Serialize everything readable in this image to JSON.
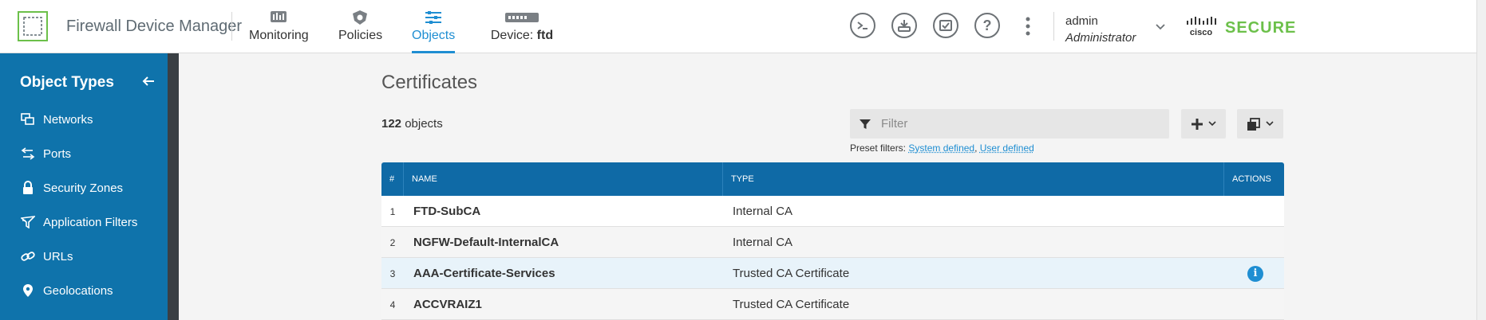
{
  "header": {
    "app_title": "Firewall Device Manager",
    "nav": [
      {
        "label": "Monitoring",
        "icon": "monitoring-icon"
      },
      {
        "label": "Policies",
        "icon": "policies-icon"
      },
      {
        "label": "Objects",
        "icon": "objects-icon",
        "active": true
      },
      {
        "label_prefix": "Device: ",
        "label_bold": "ftd",
        "icon": "device-icon"
      }
    ],
    "user": {
      "name": "admin",
      "role": "Administrator"
    },
    "brand": {
      "cisco": "cisco",
      "secure": "SECURE"
    }
  },
  "sidebar": {
    "title": "Object Types",
    "items": [
      {
        "label": "Networks",
        "icon": "networks-icon"
      },
      {
        "label": "Ports",
        "icon": "ports-icon"
      },
      {
        "label": "Security Zones",
        "icon": "lock-icon"
      },
      {
        "label": "Application Filters",
        "icon": "application-filters-icon"
      },
      {
        "label": "URLs",
        "icon": "link-icon"
      },
      {
        "label": "Geolocations",
        "icon": "location-pin-icon"
      }
    ]
  },
  "main": {
    "title": "Certificates",
    "count_number": "122",
    "count_suffix": " objects",
    "filter_placeholder": "Filter",
    "preset_label": "Preset filters:",
    "preset_filters": [
      "System defined",
      "User defined"
    ],
    "table": {
      "columns": [
        "#",
        "NAME",
        "TYPE",
        "ACTIONS"
      ],
      "rows": [
        {
          "num": "1",
          "name": "FTD-SubCA",
          "type": "Internal CA"
        },
        {
          "num": "2",
          "name": "NGFW-Default-InternalCA",
          "type": "Internal CA"
        },
        {
          "num": "3",
          "name": "AAA-Certificate-Services",
          "type": "Trusted CA Certificate",
          "action_icon": "info-icon",
          "action_glyph": "i"
        },
        {
          "num": "4",
          "name": "ACCVRAIZ1",
          "type": "Trusted CA Certificate"
        }
      ]
    }
  },
  "colors": {
    "accent": "#1f8ed2",
    "sidebar_bg": "#0f73ab",
    "table_header": "#0f6aa6",
    "brand_green": "#6cc04a"
  }
}
